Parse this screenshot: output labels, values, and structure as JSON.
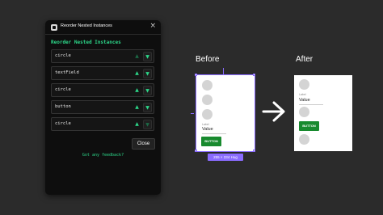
{
  "plugin": {
    "title": "Reorder Nested Instances",
    "close_icon": "×",
    "heading": "Reorder Nested Instances",
    "items": [
      {
        "label": "circle",
        "up": "▲",
        "down": "▼",
        "up_active": false
      },
      {
        "label": "textField",
        "up": "▲",
        "down": "▼",
        "up_active": true
      },
      {
        "label": "circle",
        "up": "▲",
        "down": "▼",
        "up_active": true
      },
      {
        "label": "button",
        "up": "▲",
        "down": "▼",
        "up_active": true
      },
      {
        "label": "circle",
        "up": "▲",
        "down": "▼",
        "up_active": true,
        "down_dim": true
      }
    ],
    "close_label": "Close",
    "feedback": "Got any feedback?"
  },
  "comparison": {
    "before_title": "Before",
    "after_title": "After",
    "size_badge": "255 × 334 Hug",
    "textfield_label": "Label",
    "textfield_value": "Value",
    "button_label": "BUTTON"
  },
  "colors": {
    "accent_green": "#2dd88a",
    "selection_purple": "#8a6cff",
    "button_green": "#188a2e"
  }
}
